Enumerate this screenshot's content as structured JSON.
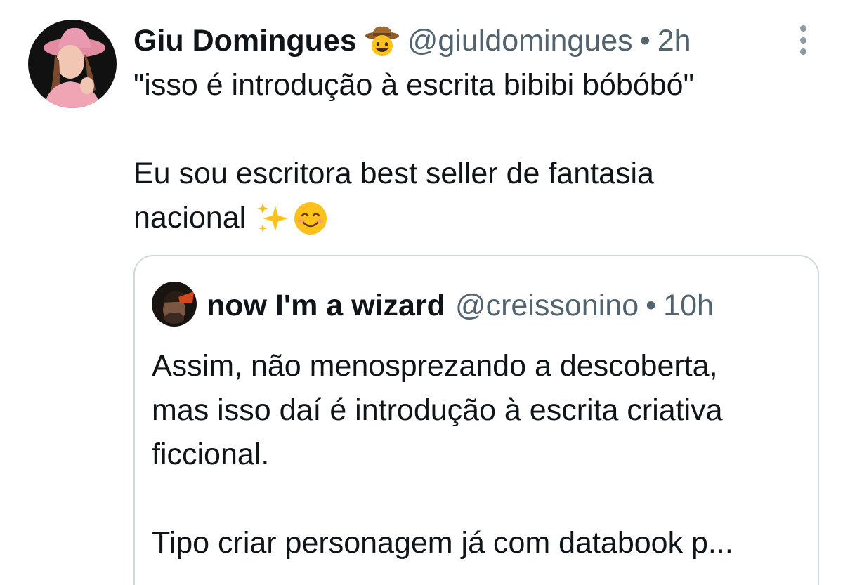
{
  "post": {
    "author": {
      "display_name": "Giu Domingues",
      "name_emoji": "cowboy-face-emoji",
      "handle": "@giuldomingues",
      "separator": "•",
      "time": "2h"
    },
    "text_line1": "\"isso é introdução à escrita bibibi bóbóbó\"",
    "text_line2": "Eu sou escritora best seller de fantasia",
    "text_line3": "nacional",
    "text_emojis": [
      "sparkles-emoji",
      "smiling-face-emoji"
    ],
    "colors": {
      "text": "#0f1419",
      "secondary": "#536471",
      "border": "#cfd9de"
    }
  },
  "quoted": {
    "author": {
      "display_name": "now I'm a wizard",
      "handle": "@creissonino",
      "separator": "•",
      "time": "10h"
    },
    "text_line1": "Assim, não menosprezando a descoberta,",
    "text_line2": "mas isso daí é introdução à escrita criativa",
    "text_line3": "ficcional.",
    "text_line4": "Tipo criar personagem já com databook p..."
  }
}
